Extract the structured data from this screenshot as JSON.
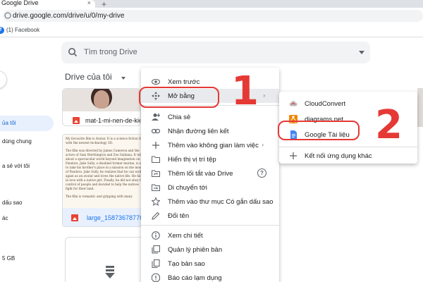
{
  "browser": {
    "tab_title": "Google Drive",
    "tab_close": "×",
    "new_tab": "+",
    "url": "drive.google.com/drive/u/0/my-drive",
    "bookmark": "(1) Facebook",
    "bookmark_icon": "f"
  },
  "search": {
    "placeholder": "Tìm trong Drive"
  },
  "drive": {
    "title": "Drive của tôi"
  },
  "sidebar": {
    "items": [
      {
        "label": "ủa tôi",
        "active": true
      },
      {
        "label": "dùng chung",
        "active": false
      },
      {
        "label": "a sẻ với tôi",
        "active": false
      },
      {
        "label": "dấu sao",
        "active": false
      },
      {
        "label": "ác",
        "active": false
      },
      {
        "label": "5 GB",
        "active": false
      }
    ]
  },
  "files": [
    {
      "name": "mat-1-mi-nen-de-kiem-tra"
    },
    {
      "name": "large_1587367877677"
    }
  ],
  "doc_preview": {
    "paragraphs": [
      "My favourite film is Avatar. It is a science fiction film with the newest technology 3D.",
      "The film was directed by James Cameron and the actors of Sam Worthington and Zoe Saldana. It tells about a spectacular world beyond imagination on Pandora. Jake Sully, a disabled former marine, is sent to take his brother's place in a mission on the moon of Pandora. Jake Sully, he realizes that he can walk again as an avatar and loves the native life. He falls in love with a native girl. Finally, he did not obey the control of people and decided to help the natives fight for their land.",
      "The film is romantic and gripping with many"
    ]
  },
  "context_menu": {
    "items": [
      {
        "label": "Xem trước",
        "icon": "eye-icon"
      },
      {
        "label": "Mở bằng",
        "icon": "open-with-icon",
        "arrow": "›"
      },
      {
        "label": "Chia sẻ",
        "icon": "share-person-icon"
      },
      {
        "label": "Nhận đường liên kết",
        "icon": "link-icon"
      },
      {
        "label": "Thêm vào không gian làm việc",
        "icon": "plus-icon",
        "arrow": "›"
      },
      {
        "label": "Hiển thị vị trí tệp",
        "icon": "folder-icon"
      },
      {
        "label": "Thêm lối tắt vào Drive",
        "icon": "shortcut-icon",
        "help": "?"
      },
      {
        "label": "Di chuyển tới",
        "icon": "move-icon"
      },
      {
        "label": "Thêm vào thư mục Có gắn dấu sao",
        "icon": "star-icon"
      },
      {
        "label": "Đổi tên",
        "icon": "pencil-icon"
      },
      {
        "label": "Xem chi tiết",
        "icon": "info-icon"
      },
      {
        "label": "Quản lý phiên bản",
        "icon": "history-icon"
      },
      {
        "label": "Tạo bản sao",
        "icon": "copy-icon"
      },
      {
        "label": "Báo cáo lạm dụng",
        "icon": "report-icon"
      }
    ]
  },
  "submenu": {
    "items": [
      {
        "label": "CloudConvert",
        "icon": "cloudconvert-icon"
      },
      {
        "label": "diagrams.net",
        "icon": "diagrams-icon"
      },
      {
        "label": "Google Tài liệu",
        "icon": "google-docs-icon"
      },
      {
        "label": "Kết nối ứng dụng khác",
        "icon": "plus-icon"
      }
    ]
  },
  "annotations": {
    "step1": "1",
    "step2": "2"
  },
  "colors": {
    "annotation": "#e53935",
    "accent": "#1a73e8",
    "docs_blue": "#4285f4"
  }
}
